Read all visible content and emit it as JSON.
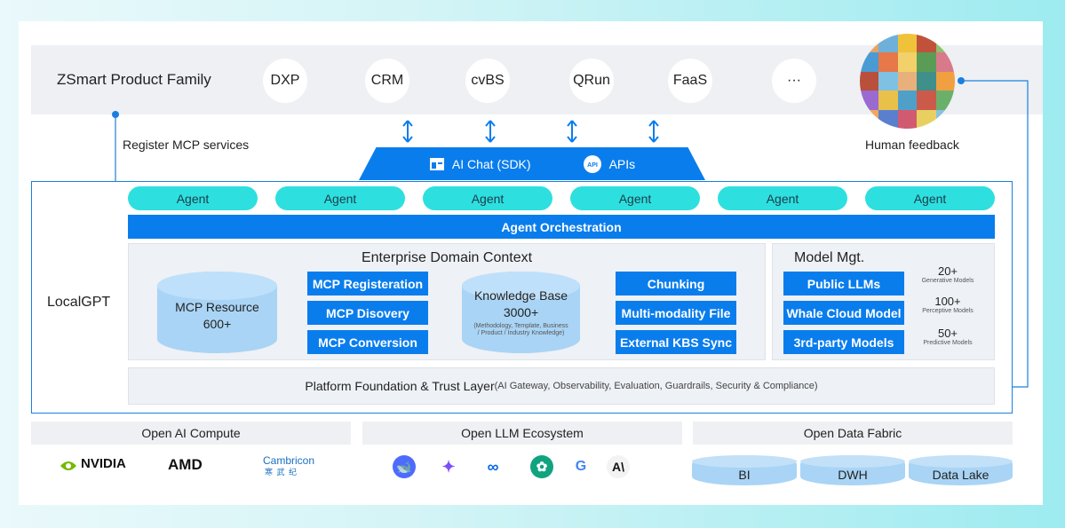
{
  "header": {
    "family": "ZSmart Product Family",
    "products": [
      "DXP",
      "CRM",
      "cvBS",
      "QRun",
      "FaaS",
      "···"
    ]
  },
  "labels": {
    "register": "Register MCP services",
    "feedback": "Human feedback",
    "localgpt": "LocalGPT"
  },
  "gateway": {
    "chat": "AI Chat (SDK)",
    "apis": "APIs",
    "api_badge": "API"
  },
  "agents": [
    "Agent",
    "Agent",
    "Agent",
    "Agent",
    "Agent",
    "Agent"
  ],
  "orchestration": "Agent Orchestration",
  "context": {
    "title": "Enterprise Domain Context",
    "mcp_resource": {
      "label": "MCP Resource",
      "count": "600+"
    },
    "mcp_buttons": [
      "MCP Registeration",
      "MCP Disovery",
      "MCP Conversion"
    ],
    "kb": {
      "label": "Knowledge Base",
      "count": "3000+",
      "note": "(Methodology, Template, Business / Product / Industry Knowledge)"
    },
    "kb_buttons": [
      "Chunking",
      "Multi-modality File",
      "External KBS Sync"
    ]
  },
  "model": {
    "title": "Model Mgt.",
    "buttons": [
      "Public LLMs",
      "Whale Cloud Model",
      "3rd-party Models"
    ],
    "stats": [
      {
        "value": "20+",
        "note": "Generative Models"
      },
      {
        "value": "100+",
        "note": "Perceptive Models"
      },
      {
        "value": "50+",
        "note": "Predictive Models"
      }
    ]
  },
  "foundation": {
    "title": "Platform Foundation & Trust Layer",
    "detail": "(AI Gateway, Observability, Evaluation, Guardrails, Security & Compliance)"
  },
  "bottom": {
    "compute": {
      "title": "Open AI Compute",
      "logos": [
        "NVIDIA",
        "AMD",
        "Cambricon",
        "寒 武 纪"
      ]
    },
    "llm": {
      "title": "Open LLM Ecosystem"
    },
    "data": {
      "title": "Open Data Fabric",
      "stores": [
        "BI",
        "DWH",
        "Data Lake"
      ]
    }
  },
  "colors": {
    "primary": "#0a7ded",
    "agent": "#2de0df",
    "cylinder": "#a9d4f5"
  }
}
